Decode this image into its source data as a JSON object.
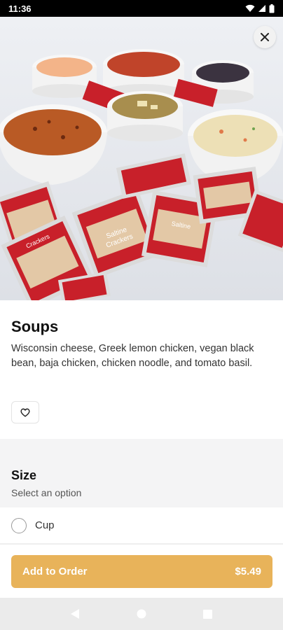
{
  "status_bar": {
    "time": "11:36"
  },
  "item": {
    "title": "Soups",
    "description": "Wisconsin cheese, Greek lemon chicken, vegan black bean, baja chicken, chicken noodle, and tomato basil."
  },
  "size": {
    "title": "Size",
    "subtitle": "Select an option",
    "options": [
      {
        "label": "Cup"
      }
    ]
  },
  "cta": {
    "label": "Add to Order",
    "price": "$5.49"
  },
  "photo": {
    "packet_label_top": "Saltine",
    "packet_label_bottom": "Crackers"
  },
  "colors": {
    "accent": "#e8b35a",
    "cracker_red": "#c8202a"
  }
}
